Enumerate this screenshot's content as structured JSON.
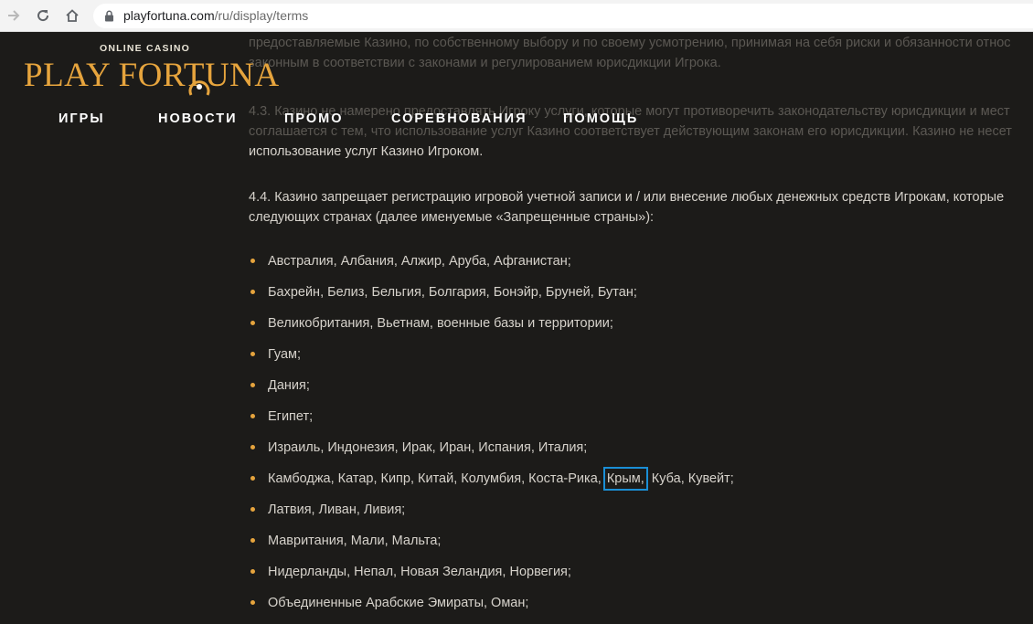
{
  "browser": {
    "url_host": "playfortuna.com",
    "url_path": "/ru/display/terms"
  },
  "logo": {
    "tagline": "ONLINE CASINO",
    "wordmark": "PLAY FORTUNA"
  },
  "nav": {
    "items": [
      "ИГРЫ",
      "НОВОСТИ",
      "ПРОМО",
      "СОРЕВНОВАНИЯ",
      "ПОМОЩЬ"
    ]
  },
  "terms": {
    "p42_line1": "предоставляемые Казино, по собственному выбору и по своему усмотрению, принимая на себя риски и обязанности относ",
    "p42_line2": "законным в соответствии с законами и регулированием юрисдикции Игрока.",
    "p43_line1": "4.3. Казино не намерено предоставлять Игроку услуги, которые могут противоречить законодательству юрисдикции и мест",
    "p43_line2": "соглашается с тем, что использование услуг Казино соответствует действующим законам его юрисдикции. Казино не несет",
    "p43_line3": "использование услуг Казино Игроком.",
    "p44_line1": "4.4. Казино запрещает регистрацию игровой учетной записи и / или внесение любых денежных средств Игрокам, которые",
    "p44_line2": "следующих странах (далее именуемые «Запрещенные страны»):",
    "countries": [
      "Австралия, Албания, Алжир, Аруба, Афганистан;",
      "Бахрейн, Белиз, Бельгия, Болгария, Бонэйр, Бруней, Бутан;",
      "Великобритания, Вьетнам, военные базы и территории;",
      "Гуам;",
      "Дания;",
      "Египет;",
      "Израиль, Индонезия, Ирак, Иран, Испания, Италия;",
      "",
      "Латвия, Ливан, Ливия;",
      "Мавритания, Мали, Мальта;",
      "Нидерланды, Непал, Новая Зеландия, Норвегия;",
      "Объединенные Арабские Эмираты, Оман;"
    ],
    "cambodia_line": {
      "before": "Камбоджа, Катар, Кипр, Китай, Колумбия, Коста-Рика, ",
      "highlight": "Крым,",
      "after": " Куба, Кувейт;"
    }
  },
  "colors": {
    "background": "#1c1b19",
    "accent_gold": "#e6a43d",
    "highlight_box": "#1a8fd6",
    "text": "#d6d2cb"
  },
  "icons": {
    "back": "arrow-right-icon",
    "reload": "reload-icon",
    "home": "home-icon",
    "lock": "lock-icon"
  }
}
